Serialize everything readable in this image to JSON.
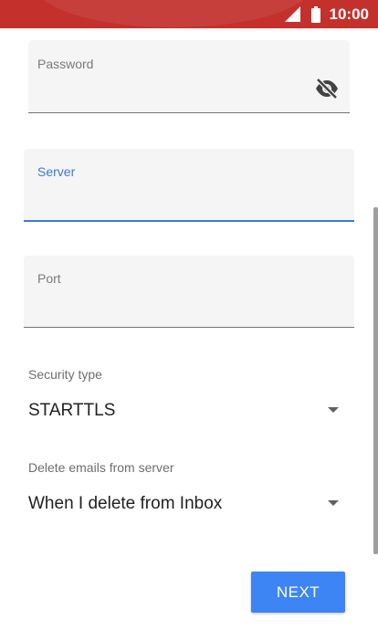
{
  "status_bar": {
    "time": "10:00",
    "signal_icon": "signal-icon",
    "battery_icon": "battery-icon",
    "color": "#c4302b"
  },
  "form": {
    "password": {
      "label": "Password",
      "value": "",
      "toggle_icon": "visibility-off-icon"
    },
    "server": {
      "label": "Server",
      "value": "",
      "focused": true,
      "accent": "#3a7bd5"
    },
    "port": {
      "label": "Port",
      "value": ""
    },
    "security_type": {
      "label": "Security type",
      "value": "STARTTLS"
    },
    "delete_emails": {
      "label": "Delete emails from server",
      "value": "When I delete from Inbox"
    }
  },
  "actions": {
    "next_label": "NEXT",
    "next_color": "#3d85f5"
  }
}
